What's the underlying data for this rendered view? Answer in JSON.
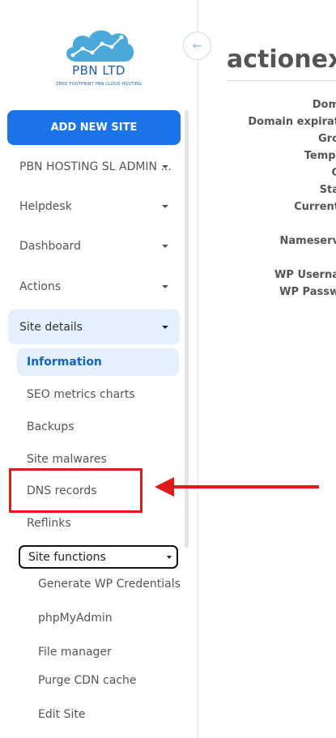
{
  "logo": {
    "name": "PBN LTD",
    "tagline": "ZERO FOOTPRINT PBN CLOUD HOSTING",
    "color": "#4aa9d8"
  },
  "sidebar": {
    "add_button": "ADD NEW SITE",
    "menu": [
      {
        "label": "PBN HOSTING SL ADMIN ...",
        "icon": "chevron-down-icon"
      },
      {
        "label": "Helpdesk",
        "icon": "chevron-down-icon"
      },
      {
        "label": "Dashboard",
        "icon": "chevron-down-icon"
      },
      {
        "label": "Actions",
        "icon": "chevron-down-icon"
      },
      {
        "label": "Site details",
        "icon": "chevron-down-icon",
        "expanded": true
      }
    ],
    "site_details_items": [
      "Information",
      "SEO metrics charts",
      "Backups",
      "Site malwares",
      "DNS records",
      "Reflinks"
    ],
    "site_functions": {
      "label": "Site functions",
      "items": [
        "Generate WP Credentials",
        "phpMyAdmin",
        "File manager",
        "Purge CDN cache",
        "Edit Site"
      ]
    }
  },
  "main": {
    "title": "actionexl",
    "fields": [
      "Dom",
      "Domain expirat",
      "Gro",
      "Templ",
      "C",
      "Sta",
      "Current",
      "Nameserv",
      "WP Userna",
      "WP Passw"
    ]
  },
  "annotation": {
    "color": "#e0191b",
    "target": "DNS records"
  },
  "colors": {
    "primary": "#1a73e8",
    "active_bg": "#e4f0fb",
    "active_text": "#1565c0"
  }
}
